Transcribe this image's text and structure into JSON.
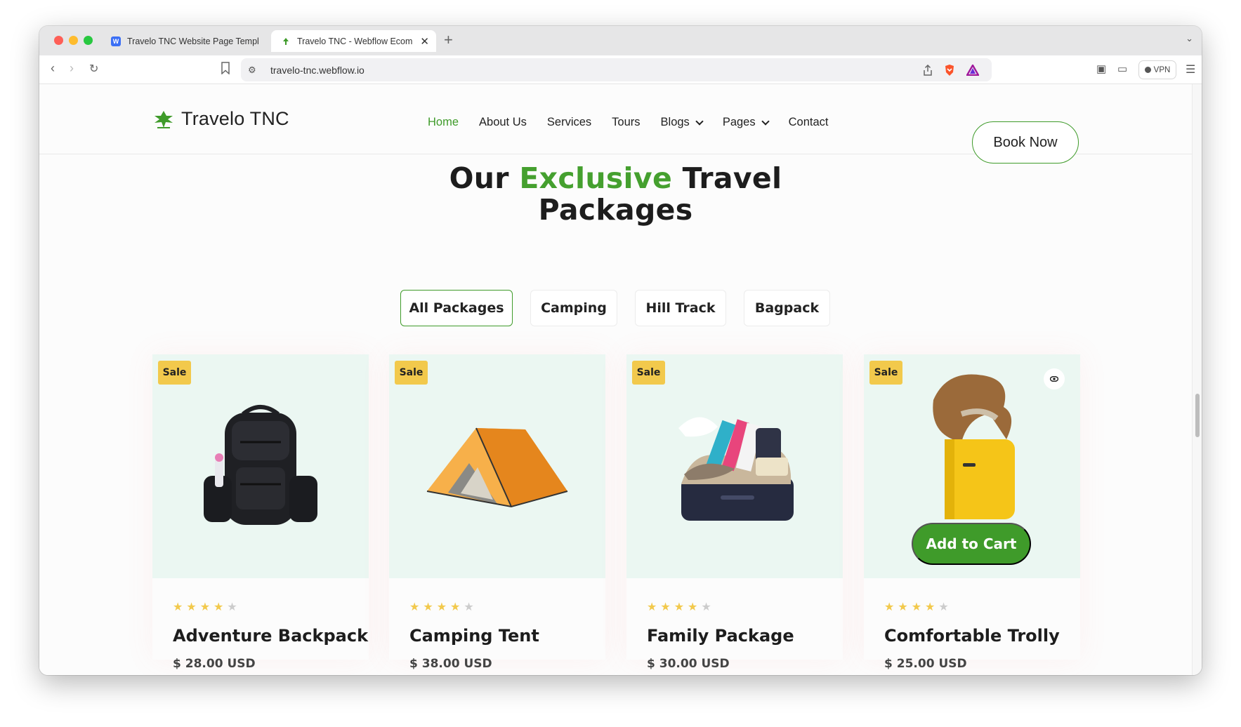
{
  "browser": {
    "tabs": [
      {
        "title": "Travelo TNC Website Page Templ",
        "active": false
      },
      {
        "title": "Travelo TNC - Webflow Ecom",
        "active": true
      }
    ],
    "url": "travelo-tnc.webflow.io",
    "vpn_label": "VPN"
  },
  "site": {
    "logo_text": "Travelo TNC",
    "nav": [
      {
        "label": "Home",
        "active": true
      },
      {
        "label": "About Us"
      },
      {
        "label": "Services"
      },
      {
        "label": "Tours"
      },
      {
        "label": "Blogs",
        "dropdown": true
      },
      {
        "label": "Pages",
        "dropdown": true
      },
      {
        "label": "Contact"
      }
    ],
    "book_now": "Book Now",
    "accent_color": "#3f9b2a"
  },
  "section": {
    "title_part1": "Our ",
    "title_highlight": "Exclusive",
    "title_part2": " Travel",
    "title_line2": "Packages",
    "filters": [
      "All Packages",
      "Camping",
      "Hill Track",
      "Bagpack"
    ],
    "active_filter": "All Packages"
  },
  "products": [
    {
      "badge": "Sale",
      "name": "Adventure Backpack",
      "price": "$ 28.00 USD",
      "rating": 4,
      "image": "backpack"
    },
    {
      "badge": "Sale",
      "name": "Camping Tent",
      "price": "$ 38.00 USD",
      "rating": 4,
      "image": "tent"
    },
    {
      "badge": "Sale",
      "name": "Family Package",
      "price": "$ 30.00 USD",
      "rating": 4,
      "image": "suitcase-packed"
    },
    {
      "badge": "Sale",
      "name": "Comfortable Trolly",
      "price": "$ 25.00 USD",
      "rating": 4,
      "image": "yellow-trolley-with-hat",
      "add_to_cart": "Add to Cart"
    }
  ]
}
